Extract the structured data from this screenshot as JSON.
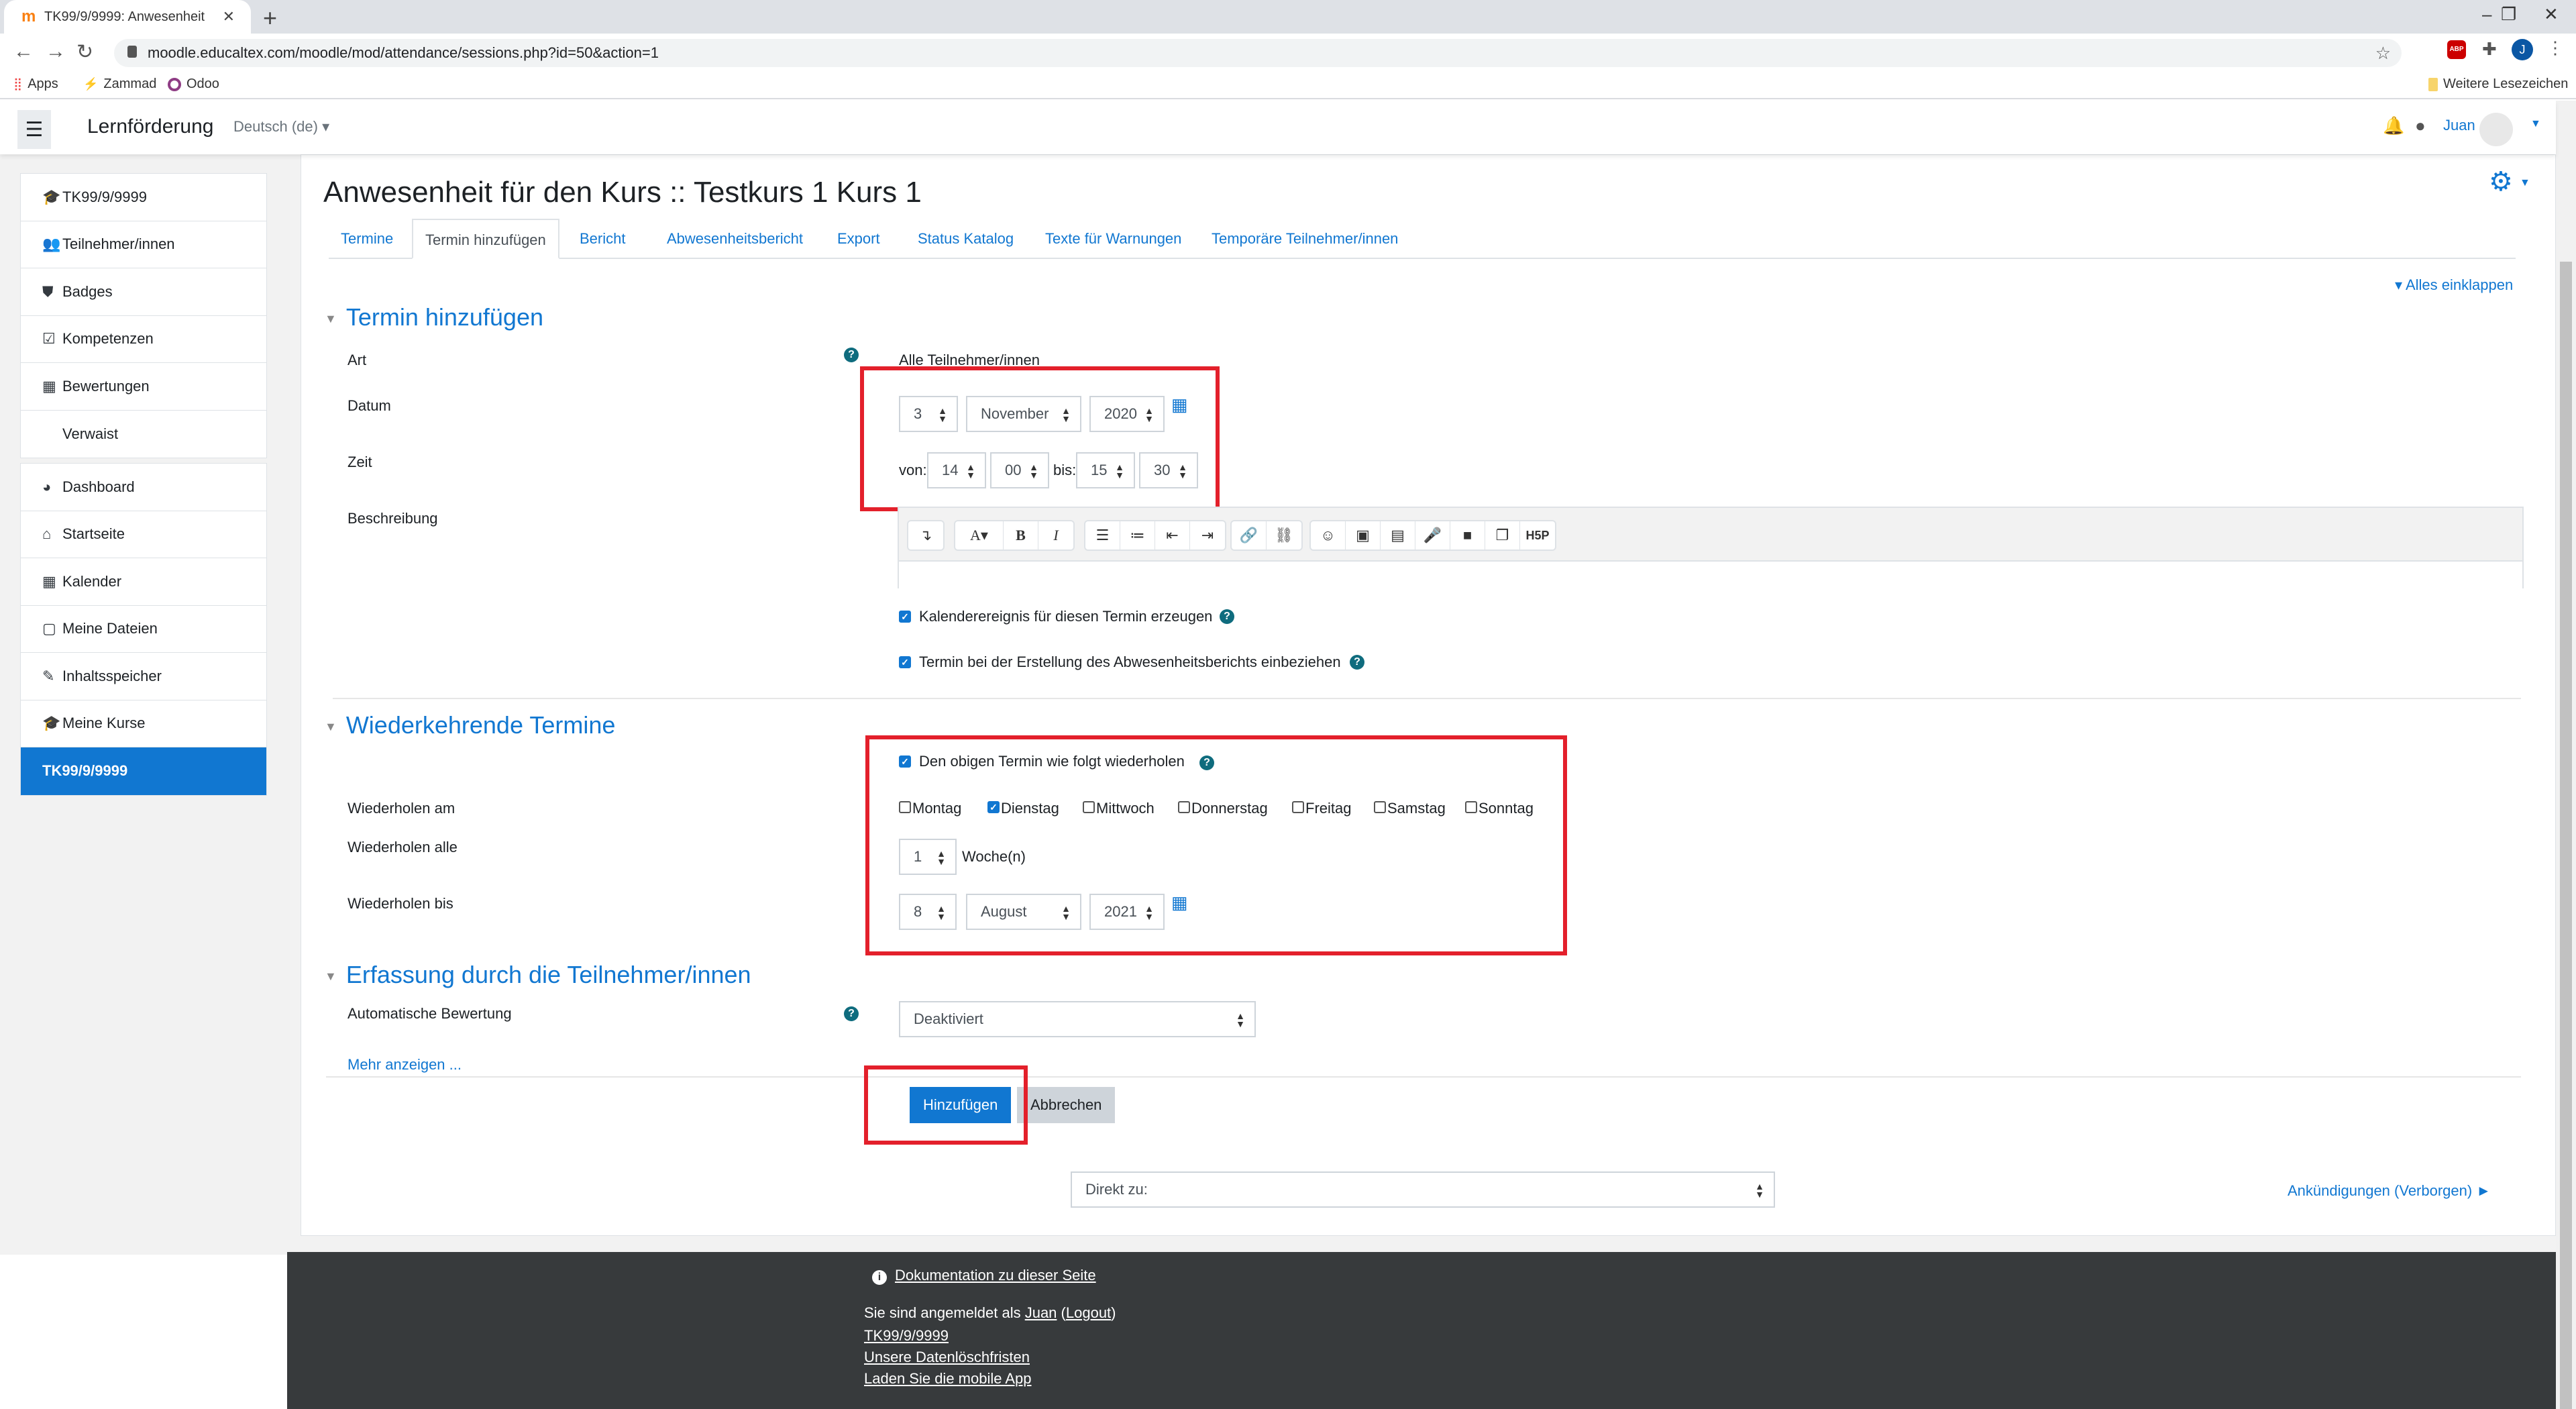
{
  "browser": {
    "tab_title": "TK99/9/9999: Anwesenheit",
    "url": "moodle.educaltex.com/moodle/mod/attendance/sessions.php?id=50&action=1",
    "bookmarks": [
      "Apps",
      "Zammad",
      "Odoo"
    ],
    "other_bookmarks": "Weitere Lesezeichen",
    "profile_initial": "J",
    "adblock_label": "ABP"
  },
  "navbar": {
    "site_name": "Lernförderung",
    "language": "Deutsch (de)",
    "user_name": "Juan"
  },
  "sidebar": {
    "course_group": [
      {
        "icon": "graduation-cap-icon",
        "glyph": "🎓",
        "label": "TK99/9/9999"
      },
      {
        "icon": "users-icon",
        "glyph": "👥",
        "label": "Teilnehmer/innen"
      },
      {
        "icon": "shield-icon",
        "glyph": "⛊",
        "label": "Badges"
      },
      {
        "icon": "check-square-icon",
        "glyph": "☑",
        "label": "Kompetenzen"
      },
      {
        "icon": "table-icon",
        "glyph": "▦",
        "label": "Bewertungen"
      },
      {
        "icon": "",
        "glyph": "",
        "label": "Verwaist"
      }
    ],
    "site_group": [
      {
        "icon": "dashboard-icon",
        "glyph": "◕",
        "label": "Dashboard"
      },
      {
        "icon": "home-icon",
        "glyph": "⌂",
        "label": "Startseite"
      },
      {
        "icon": "calendar-icon",
        "glyph": "▦",
        "label": "Kalender"
      },
      {
        "icon": "file-icon",
        "glyph": "▢",
        "label": "Meine Dateien"
      },
      {
        "icon": "paintbrush-icon",
        "glyph": "✎",
        "label": "Inhaltsspeicher"
      },
      {
        "icon": "graduation-cap-icon",
        "glyph": "🎓",
        "label": "Meine Kurse"
      },
      {
        "icon": "",
        "glyph": "",
        "label": "TK99/9/9999",
        "active": true
      }
    ]
  },
  "page": {
    "title": "Anwesenheit für den Kurs :: Testkurs 1 Kurs 1",
    "tabs": [
      {
        "label": "Termine",
        "active": false
      },
      {
        "label": "Termin hinzufügen",
        "active": true
      },
      {
        "label": "Bericht",
        "active": false
      },
      {
        "label": "Abwesenheitsbericht",
        "active": false
      },
      {
        "label": "Export",
        "active": false
      },
      {
        "label": "Status Katalog",
        "active": false
      },
      {
        "label": "Texte für Warnungen",
        "active": false
      },
      {
        "label": "Temporäre Teilnehmer/innen",
        "active": false
      }
    ],
    "collapse_all": "Alles einklappen"
  },
  "form": {
    "section_add": {
      "heading": "Termin hinzufügen",
      "art_label": "Art",
      "art_value": "Alle Teilnehmer/innen",
      "datum_label": "Datum",
      "datum": {
        "day": "3",
        "month": "November",
        "year": "2020"
      },
      "zeit_label": "Zeit",
      "zeit_from_label": "von:",
      "zeit_to_label": "bis:",
      "zeit": {
        "from_hour": "14",
        "from_minute": "00",
        "to_hour": "15",
        "to_minute": "30"
      },
      "beschreibung_label": "Beschreibung",
      "calendar_event_label": "Kalenderereignis für diesen Termin erzeugen",
      "calendar_event_checked": true,
      "include_report_label": "Termin bei der Erstellung des Abwesenheitsberichts einbeziehen",
      "include_report_checked": true
    },
    "section_repeat": {
      "heading": "Wiederkehrende Termine",
      "repeat_label": "Den obigen Termin wie folgt wiederholen",
      "repeat_checked": true,
      "repeat_on_label": "Wiederholen am",
      "days": [
        {
          "label": "Montag",
          "checked": false
        },
        {
          "label": "Dienstag",
          "checked": true
        },
        {
          "label": "Mittwoch",
          "checked": false
        },
        {
          "label": "Donnerstag",
          "checked": false
        },
        {
          "label": "Freitag",
          "checked": false
        },
        {
          "label": "Samstag",
          "checked": false
        },
        {
          "label": "Sonntag",
          "checked": false
        }
      ],
      "repeat_every_label": "Wiederholen alle",
      "repeat_every_value": "1",
      "repeat_every_unit": "Woche(n)",
      "repeat_until_label": "Wiederholen bis",
      "repeat_until": {
        "day": "8",
        "month": "August",
        "year": "2021"
      }
    },
    "section_student": {
      "heading": "Erfassung durch die Teilnehmer/innen",
      "auto_grade_label": "Automatische Bewertung",
      "auto_grade_value": "Deaktiviert",
      "show_more": "Mehr anzeigen ..."
    },
    "buttons": {
      "submit": "Hinzufügen",
      "cancel": "Abbrechen"
    }
  },
  "jump": {
    "placeholder": "Direkt zu:",
    "next_link": "Ankündigungen (Verborgen) ►"
  },
  "footer": {
    "doc_link": "Dokumentation zu dieser Seite",
    "logged_in_prefix": "Sie sind angemeldet als ",
    "user": "Juan",
    "logout": "Logout",
    "course_link": "TK99/9/9999",
    "retention_link": "Unsere Datenlöschfristen",
    "mobile_app_link": "Laden Sie die mobile App"
  },
  "colors": {
    "brand": "#1177d1",
    "highlight": "#e3202b",
    "footer_bg": "#373a3c",
    "help": "#0f6c7e"
  }
}
